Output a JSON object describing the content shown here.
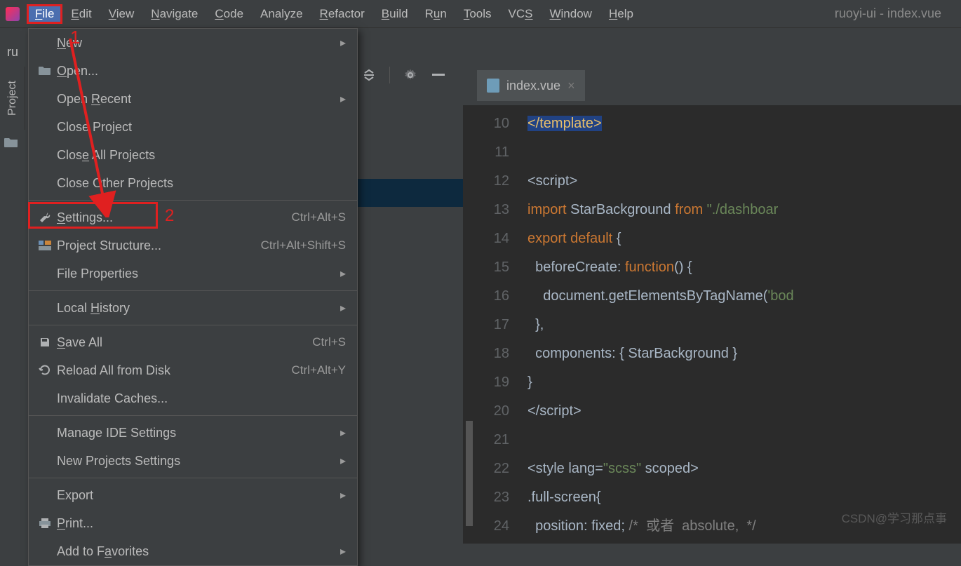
{
  "window": {
    "title": "ruoyi-ui - index.vue"
  },
  "menubar": [
    {
      "label": "File",
      "mn": "F",
      "rest": "ile",
      "active": true
    },
    {
      "label": "Edit",
      "mn": "E",
      "rest": "dit"
    },
    {
      "label": "View",
      "mn": "V",
      "rest": "iew"
    },
    {
      "label": "Navigate",
      "mn": "N",
      "rest": "avigate"
    },
    {
      "label": "Code",
      "mn": "C",
      "rest": "ode"
    },
    {
      "label": "Analyze",
      "mn": "",
      "rest": "Analyze"
    },
    {
      "label": "Refactor",
      "mn": "R",
      "rest": "efactor"
    },
    {
      "label": "Build",
      "mn": "B",
      "rest": "uild"
    },
    {
      "label": "Run",
      "mn": "",
      "rest": "R",
      "mn2": "u",
      "rest2": "n"
    },
    {
      "label": "Tools",
      "mn": "T",
      "rest": "ools"
    },
    {
      "label": "VCS",
      "mn": "",
      "rest": "VC",
      "mn2": "S",
      "rest2": ""
    },
    {
      "label": "Window",
      "mn": "W",
      "rest": "indow"
    },
    {
      "label": "Help",
      "mn": "H",
      "rest": "elp"
    }
  ],
  "sidebar": {
    "tab_label": "Project"
  },
  "crumb": {
    "text": "ru"
  },
  "toolbar": {
    "collapse": "⇕",
    "settings": "⚙",
    "hide": "—"
  },
  "file_tab": {
    "name": "index.vue",
    "close": "×"
  },
  "dropdown": [
    {
      "type": "item",
      "label": "New",
      "mn": "N",
      "rest": "ew",
      "submenu": true,
      "name": "menu-new"
    },
    {
      "type": "item",
      "label": "Open...",
      "mn": "O",
      "rest": "pen...",
      "icon": "folder",
      "name": "menu-open"
    },
    {
      "type": "item",
      "label": "Open Recent",
      "mn": "",
      "pre": "Open ",
      "mn2": "R",
      "rest": "ecent",
      "submenu": true,
      "name": "menu-open-recent"
    },
    {
      "type": "item",
      "label": "Close Project",
      "mn": "",
      "pre": "Close Pro",
      "mn2": "j",
      "rest": "ect",
      "name": "menu-close-project"
    },
    {
      "type": "item",
      "label": "Close All Projects",
      "mn": "",
      "pre": "Clos",
      "mn2": "e",
      "rest": " All Projects",
      "name": "menu-close-all"
    },
    {
      "type": "item",
      "label": "Close Other Projects",
      "mn": "",
      "rest": "Close Other Projects",
      "name": "menu-close-other"
    },
    {
      "type": "sep"
    },
    {
      "type": "item",
      "label": "Settings...",
      "mn": "S",
      "rest": "ettings...",
      "shortcut": "Ctrl+Alt+S",
      "icon": "wrench",
      "name": "menu-settings"
    },
    {
      "type": "item",
      "label": "Project Structure...",
      "mn": "",
      "rest": "Project Structure...",
      "shortcut": "Ctrl+Alt+Shift+S",
      "icon": "structure",
      "name": "menu-project-structure"
    },
    {
      "type": "item",
      "label": "File Properties",
      "mn": "",
      "rest": "File Properties",
      "submenu": true,
      "name": "menu-file-props"
    },
    {
      "type": "sep"
    },
    {
      "type": "item",
      "label": "Local History",
      "mn": "",
      "pre": "Local ",
      "mn2": "H",
      "rest": "istory",
      "submenu": true,
      "name": "menu-local-history"
    },
    {
      "type": "sep"
    },
    {
      "type": "item",
      "label": "Save All",
      "mn": "S",
      "rest": "ave All",
      "shortcut": "Ctrl+S",
      "icon": "save",
      "name": "menu-save-all"
    },
    {
      "type": "item",
      "label": "Reload All from Disk",
      "mn": "",
      "rest": "Reload All from Disk",
      "shortcut": "Ctrl+Alt+Y",
      "icon": "reload",
      "name": "menu-reload"
    },
    {
      "type": "item",
      "label": "Invalidate Caches...",
      "mn": "",
      "rest": "Invalidate Caches...",
      "name": "menu-invalidate"
    },
    {
      "type": "sep"
    },
    {
      "type": "item",
      "label": "Manage IDE Settings",
      "mn": "",
      "rest": "Manage IDE Settings",
      "submenu": true,
      "name": "menu-manage-ide"
    },
    {
      "type": "item",
      "label": "New Projects Settings",
      "mn": "",
      "rest": "New Projects Settings",
      "submenu": true,
      "name": "menu-new-proj-settings"
    },
    {
      "type": "sep"
    },
    {
      "type": "item",
      "label": "Export",
      "mn": "",
      "rest": "Export",
      "submenu": true,
      "name": "menu-export"
    },
    {
      "type": "item",
      "label": "Print...",
      "mn": "P",
      "rest": "rint...",
      "icon": "print",
      "name": "menu-print"
    },
    {
      "type": "item",
      "label": "Add to Favorites",
      "mn": "",
      "pre": "Add to F",
      "mn2": "a",
      "rest": "vorites",
      "submenu": true,
      "name": "menu-favorites"
    }
  ],
  "annotations": {
    "one": "1",
    "two": "2"
  },
  "line_start": 10,
  "code_lines": [
    {
      "html": "<span class='sel'>&lt;/template&gt;</span>"
    },
    {
      "html": ""
    },
    {
      "html": "&lt;script&gt;"
    },
    {
      "html": "<span class='kw'>import</span> StarBackground <span class='kw'>from</span> <span class='str'>\"./dashboar</span>"
    },
    {
      "html": "<span class='kw'>export default</span> {"
    },
    {
      "html": "  beforeCreate: <span class='kw'>function</span>() {"
    },
    {
      "html": "    document.getElementsByTagName(<span class='str'>'bod</span>"
    },
    {
      "html": "  },"
    },
    {
      "html": "  components: { StarBackground }"
    },
    {
      "html": "}"
    },
    {
      "html": "&lt;/script&gt;"
    },
    {
      "html": ""
    },
    {
      "html": "&lt;style <span>lang</span>=<span class='str'>\"scss\"</span> scoped&gt;"
    },
    {
      "html": ".full-screen{"
    },
    {
      "html": "  position: fixed; <span class='cmt'>/*  或者  absolute,  */</span>"
    }
  ],
  "watermark": "CSDN@学习那点事"
}
